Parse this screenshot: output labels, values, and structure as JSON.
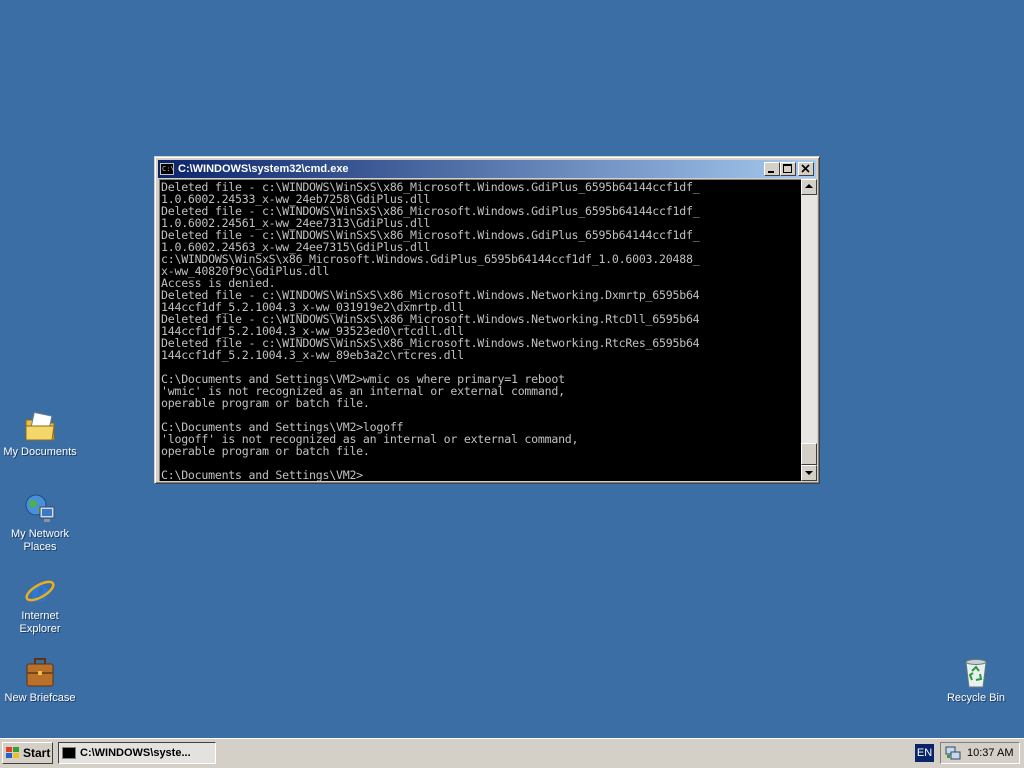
{
  "desktop": {
    "icons": [
      {
        "label": "My Documents"
      },
      {
        "label": "My Network\nPlaces"
      },
      {
        "label": "Internet\nExplorer"
      },
      {
        "label": "New Briefcase"
      },
      {
        "label": "Recycle Bin"
      }
    ]
  },
  "window": {
    "title": "C:\\WINDOWS\\system32\\cmd.exe",
    "icon": "console-icon",
    "controls": [
      "minimize",
      "maximize",
      "close"
    ]
  },
  "console": {
    "lines": [
      "Deleted file - c:\\WINDOWS\\WinSxS\\x86_Microsoft.Windows.GdiPlus_6595b64144ccf1df_",
      "1.0.6002.24533_x-ww_24eb7258\\GdiPlus.dll",
      "Deleted file - c:\\WINDOWS\\WinSxS\\x86_Microsoft.Windows.GdiPlus_6595b64144ccf1df_",
      "1.0.6002.24561_x-ww_24ee7313\\GdiPlus.dll",
      "Deleted file - c:\\WINDOWS\\WinSxS\\x86_Microsoft.Windows.GdiPlus_6595b64144ccf1df_",
      "1.0.6002.24563_x-ww_24ee7315\\GdiPlus.dll",
      "c:\\WINDOWS\\WinSxS\\x86_Microsoft.Windows.GdiPlus_6595b64144ccf1df_1.0.6003.20488_",
      "x-ww_40820f9c\\GdiPlus.dll",
      "Access is denied.",
      "Deleted file - c:\\WINDOWS\\WinSxS\\x86_Microsoft.Windows.Networking.Dxmrtp_6595b64",
      "144ccf1df_5.2.1004.3_x-ww_031919e2\\dxmrtp.dll",
      "Deleted file - c:\\WINDOWS\\WinSxS\\x86_Microsoft.Windows.Networking.RtcDll_6595b64",
      "144ccf1df_5.2.1004.3_x-ww_93523ed0\\rtcdll.dll",
      "Deleted file - c:\\WINDOWS\\WinSxS\\x86_Microsoft.Windows.Networking.RtcRes_6595b64",
      "144ccf1df_5.2.1004.3_x-ww_89eb3a2c\\rtcres.dll",
      "",
      "C:\\Documents and Settings\\VM2>wmic os where primary=1 reboot",
      "'wmic' is not recognized as an internal or external command,",
      "operable program or batch file.",
      "",
      "C:\\Documents and Settings\\VM2>logoff",
      "'logoff' is not recognized as an internal or external command,",
      "operable program or batch file.",
      "",
      "C:\\Documents and Settings\\VM2>"
    ]
  },
  "taskbar": {
    "start_label": "Start",
    "task_label": "C:\\WINDOWS\\syste...",
    "language": "EN",
    "clock": "10:37 AM"
  },
  "colors": {
    "desktop": "#3a6ea5",
    "title_active": "#0a246a",
    "console_bg": "#000000",
    "console_fg": "#c0c0c0"
  }
}
